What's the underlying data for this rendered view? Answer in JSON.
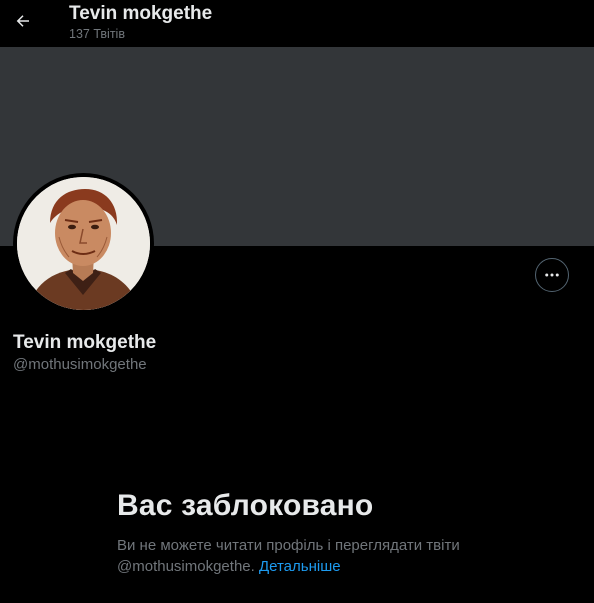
{
  "header": {
    "name": "Tevin mokgethe",
    "tweet_count": "137 Твітів",
    "back_icon": "arrow-left-icon"
  },
  "profile": {
    "name": "Tevin mokgethe",
    "handle": "@mothusimokgethe",
    "more_icon": "more-horizontal-icon"
  },
  "blocked": {
    "title": "Вас заблоковано",
    "message_prefix": "Ви не можете читати профіль і переглядати твіти",
    "message_handle": "@mothusimokgethe.",
    "link_label": "Детальніше"
  },
  "colors": {
    "background": "#000000",
    "banner": "#333639",
    "primary_text": "#e7e9ea",
    "secondary_text": "#71767b",
    "link": "#1d9bf0"
  }
}
